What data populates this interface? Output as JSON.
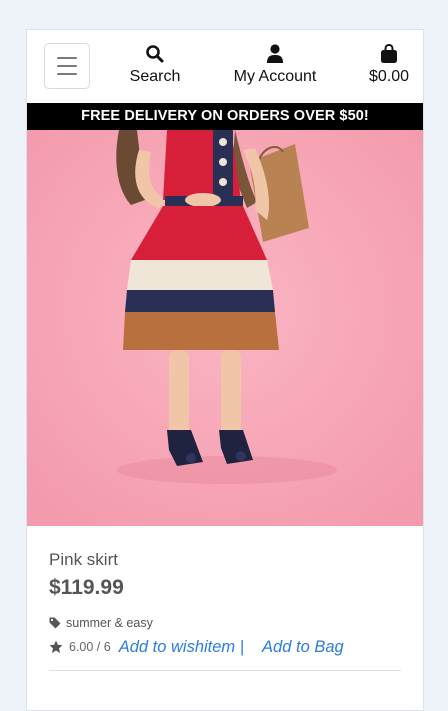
{
  "navbar": {
    "search_label": "Search",
    "account_label": "My Account",
    "bag_total": "$0.00"
  },
  "banner": {
    "text": "FREE DELIVERY ON ORDERS OVER $50!"
  },
  "product": {
    "name": "Pink skirt",
    "price": "$119.99",
    "category": "summer & easy",
    "rating": "6.00 / 6",
    "wishlist_label": "Add to wishitem |",
    "bag_label": "Add to Bag"
  },
  "colors": {
    "link": "#2b7de0",
    "background": "#eef2f9",
    "image_bg": "#f7a6b5"
  },
  "icons": [
    "menu-icon",
    "search-icon",
    "user-icon",
    "shopping-bag-icon",
    "tag-icon",
    "star-icon"
  ]
}
